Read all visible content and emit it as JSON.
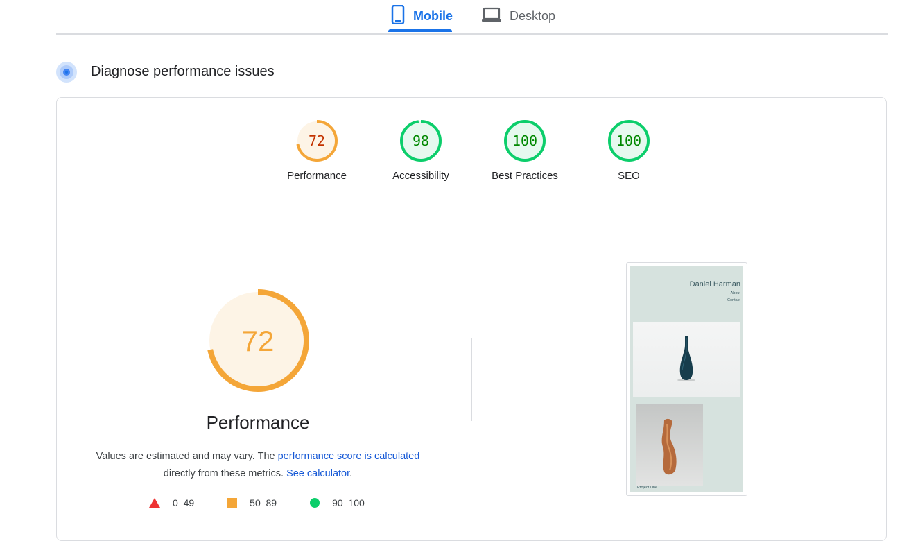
{
  "tabs": [
    {
      "label": "Mobile",
      "active": true,
      "icon": "smartphone-icon"
    },
    {
      "label": "Desktop",
      "active": false,
      "icon": "laptop-icon"
    }
  ],
  "section": {
    "title": "Diagnose performance issues",
    "icon": "diagnose-icon"
  },
  "scores": [
    {
      "label": "Performance",
      "value": "72",
      "score": 72,
      "status": "average"
    },
    {
      "label": "Accessibility",
      "value": "98",
      "score": 98,
      "status": "pass"
    },
    {
      "label": "Best Practices",
      "value": "100",
      "score": 100,
      "status": "pass"
    },
    {
      "label": "SEO",
      "value": "100",
      "score": 100,
      "status": "pass"
    }
  ],
  "performance": {
    "value": "72",
    "score": 72,
    "title": "Performance",
    "desc_prefix": "Values are estimated and may vary. The ",
    "desc_link1": "performance score is calculated",
    "desc_middle": "directly from these metrics. ",
    "desc_link2": "See calculator",
    "desc_suffix": "."
  },
  "legend": [
    {
      "range": "0–49",
      "shape": "triangle",
      "color": "#e33"
    },
    {
      "range": "50–89",
      "shape": "square",
      "color": "#f4a638"
    },
    {
      "range": "90–100",
      "shape": "circle",
      "color": "#0cce6b"
    }
  ],
  "screenshot": {
    "site_name": "Daniel Harman",
    "nav": [
      "About",
      "Contact"
    ],
    "caption": "Project One"
  },
  "colors": {
    "accent": "#1a73e8",
    "pass": "#0cce6b",
    "pass_text": "#008800",
    "pass_bg": "#e6f9ef",
    "average": "#f4a638",
    "average_text": "#c33300",
    "average_bg": "#fdf4e6"
  }
}
